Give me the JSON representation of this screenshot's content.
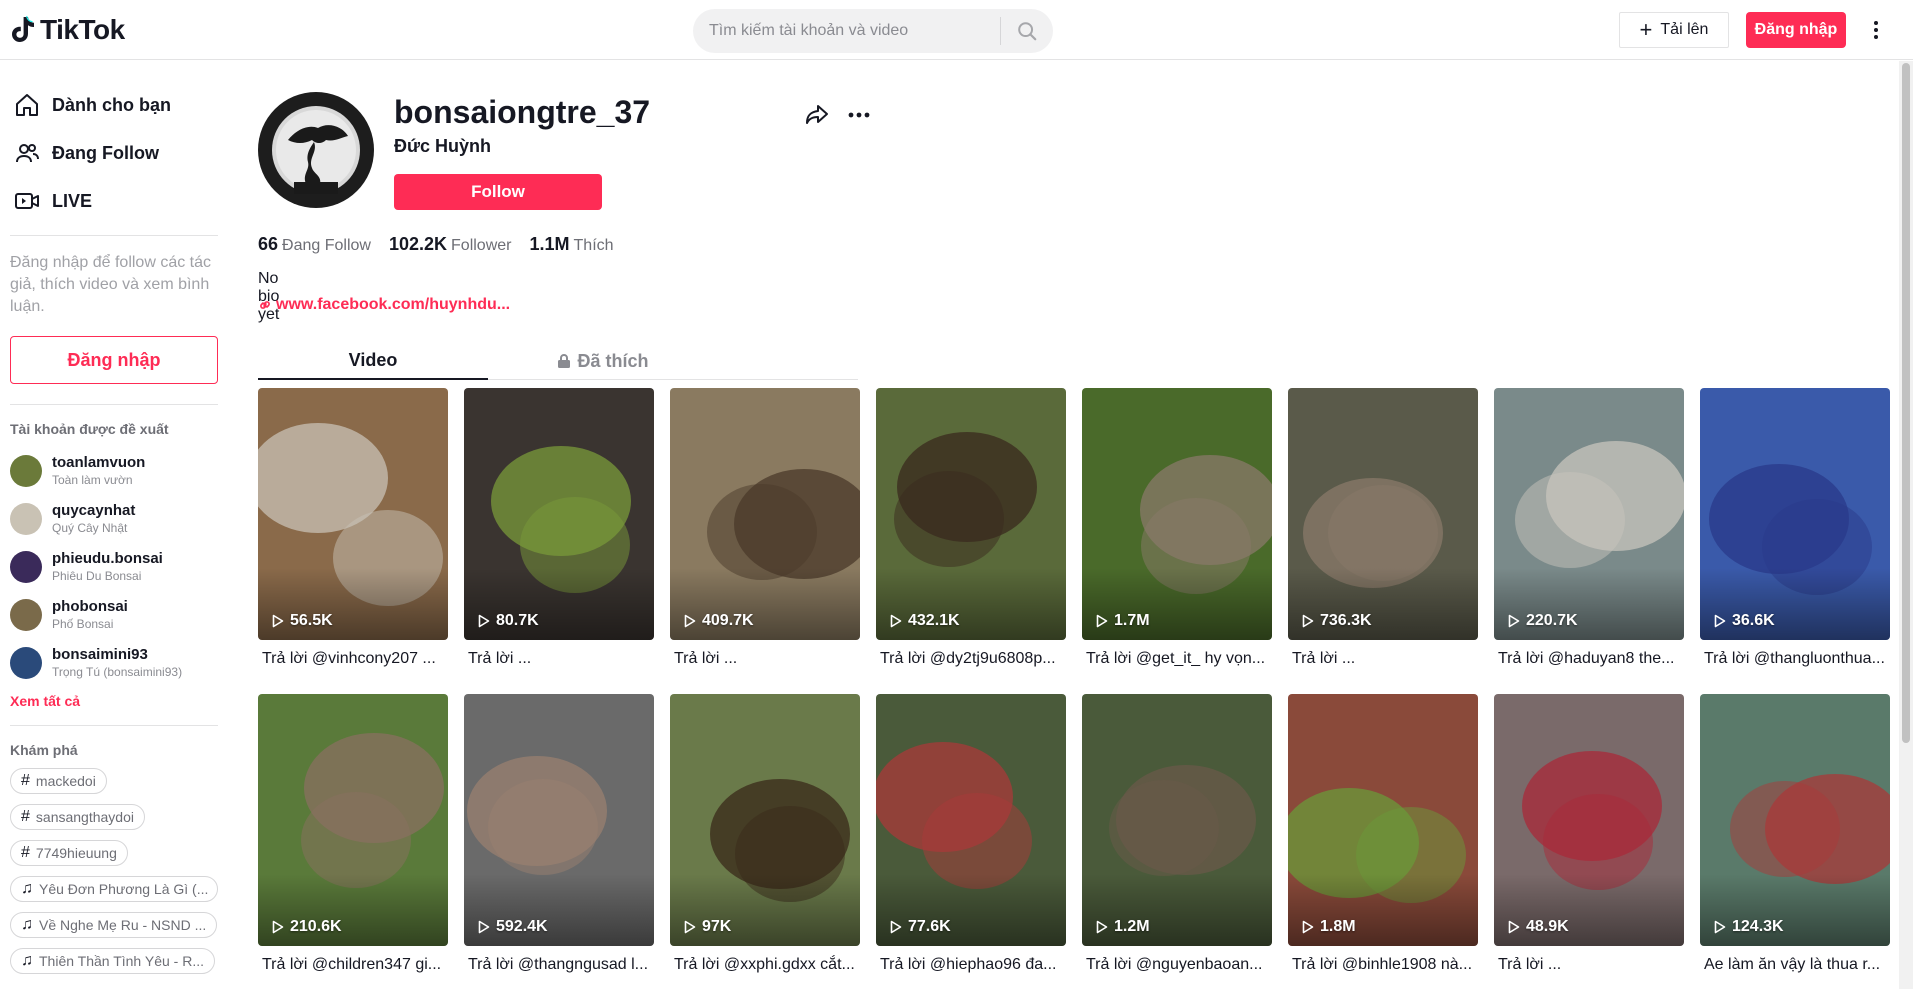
{
  "header": {
    "logo_text": "TikTok",
    "search_placeholder": "Tìm kiếm tài khoản và video",
    "upload_label": "Tải lên",
    "login_label": "Đăng nhập"
  },
  "sidebar": {
    "nav": [
      {
        "label": "Dành cho bạn",
        "icon": "home-icon"
      },
      {
        "label": "Đang Follow",
        "icon": "following-icon"
      },
      {
        "label": "LIVE",
        "icon": "live-icon"
      }
    ],
    "hint": "Đăng nhập để follow các tác giả, thích video và xem bình luận.",
    "login_label": "Đăng nhập",
    "suggested_title": "Tài khoản được đề xuất",
    "suggested": [
      {
        "name": "toanlamvuon",
        "nick": "Toàn làm vườn",
        "color": "#6b7a3a"
      },
      {
        "name": "quycaynhat",
        "nick": "Quý Cây Nhật",
        "color": "#c9c2b4"
      },
      {
        "name": "phieudu.bonsai",
        "nick": "Phiêu Du Bonsai",
        "color": "#3a2a5a"
      },
      {
        "name": "phobonsai",
        "nick": "Phố Bonsai",
        "color": "#7a6a4a"
      },
      {
        "name": "bonsaimini93",
        "nick": "Trọng Tú (bonsaimini93)",
        "color": "#2a4a7a"
      }
    ],
    "see_all": "Xem tất cả",
    "discover_title": "Khám phá",
    "discover": [
      {
        "type": "hashtag",
        "label": "mackedoi"
      },
      {
        "type": "hashtag",
        "label": "sansangthaydoi"
      },
      {
        "type": "hashtag",
        "label": "7749hieuung"
      },
      {
        "type": "music",
        "label": "Yêu Đơn Phương Là Gì (..."
      },
      {
        "type": "music",
        "label": "Về Nghe Mẹ Ru - NSND ..."
      },
      {
        "type": "music",
        "label": "Thiên Thần Tình Yêu - R..."
      }
    ]
  },
  "profile": {
    "username": "bonsaiongtre_37",
    "nickname": "Đức Huỳnh",
    "follow_label": "Follow",
    "stats": [
      {
        "num": "66",
        "label": "Đang Follow"
      },
      {
        "num": "102.2K",
        "label": "Follower"
      },
      {
        "num": "1.1M",
        "label": "Thích"
      }
    ],
    "bio": "No bio yet",
    "link": "www.facebook.com/huynhdu..."
  },
  "tabs": {
    "video": "Video",
    "liked": "Đã thích"
  },
  "videos": [
    {
      "views": "56.5K",
      "caption": "Trả lời @vinhcony207 ...",
      "bg": "#8a6a4a",
      "fg": "#c8c2b6"
    },
    {
      "views": "80.7K",
      "caption": "Trả lời ...",
      "bg": "#3a3430",
      "fg": "#7a9a3a"
    },
    {
      "views": "409.7K",
      "caption": "Trả lời ...",
      "bg": "#8a7a60",
      "fg": "#4a3a2a"
    },
    {
      "views": "432.1K",
      "caption": "Trả lời @dy2tj9u6808p...",
      "bg": "#5a6a3a",
      "fg": "#3a2a1e"
    },
    {
      "views": "1.7M",
      "caption": "Trả lời @get_it_ hy vọn...",
      "bg": "#4a6a2a",
      "fg": "#8a7a6a"
    },
    {
      "views": "736.3K",
      "caption": "Trả lời ...",
      "bg": "#5a5a4a",
      "fg": "#8a7a6a"
    },
    {
      "views": "220.7K",
      "caption": "Trả lời @haduyan8 the...",
      "bg": "#7a8a8a",
      "fg": "#c8c4bc"
    },
    {
      "views": "36.6K",
      "caption": "Trả lời @thangluonthua...",
      "bg": "#3a5aaa",
      "fg": "#2a3a8a"
    },
    {
      "views": "210.6K",
      "caption": "Trả lời @children347 gi...",
      "bg": "#5a7a3a",
      "fg": "#8a7060"
    },
    {
      "views": "592.4K",
      "caption": "Trả lời @thangngusad l...",
      "bg": "#6a6a6a",
      "fg": "#9a8070"
    },
    {
      "views": "97K",
      "caption": "Trả lời @xxphi.gdxx cắt...",
      "bg": "#6a7a4a",
      "fg": "#3a2a1a"
    },
    {
      "views": "77.6K",
      "caption": "Trả lời @hiephao96 đa...",
      "bg": "#4a5a3a",
      "fg": "#aa3a3a"
    },
    {
      "views": "1.2M",
      "caption": "Trả lời @nguyenbaoan...",
      "bg": "#4a5a3a",
      "fg": "#6a5a4a"
    },
    {
      "views": "1.8M",
      "caption": "Trả lời @binhle1908 nà...",
      "bg": "#8a4a3a",
      "fg": "#6a9a3a"
    },
    {
      "views": "48.9K",
      "caption": "Trả lời ...",
      "bg": "#7a6a6a",
      "fg": "#aa2a3a"
    },
    {
      "views": "124.3K",
      "caption": "Ae làm ăn vậy là thua r...",
      "bg": "#5a7a6a",
      "fg": "#aa3a3a"
    }
  ],
  "colors": {
    "accent": "#fe2c55",
    "text": "#161823",
    "muted": "#8a8b91"
  }
}
